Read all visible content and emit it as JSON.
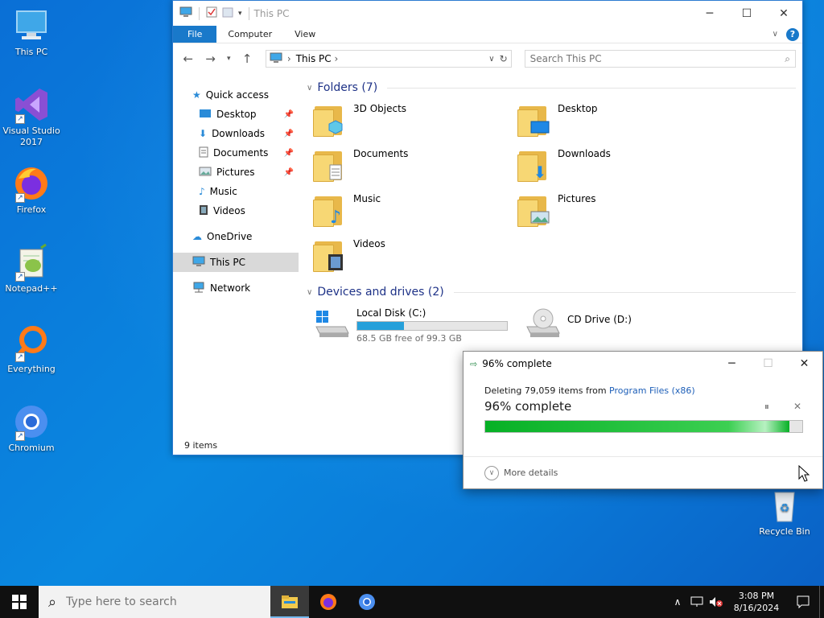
{
  "desktop": {
    "icons": [
      {
        "label": "This PC"
      },
      {
        "label": "Visual Studio 2017"
      },
      {
        "label": "Firefox"
      },
      {
        "label": "Notepad++"
      },
      {
        "label": "Everything"
      },
      {
        "label": "Chromium"
      },
      {
        "label": "Recycle Bin"
      }
    ]
  },
  "explorer": {
    "title": "This PC",
    "ribbon_tabs": [
      "File",
      "Computer",
      "View"
    ],
    "help_label": "?",
    "address": "This PC",
    "search_placeholder": "Search This PC",
    "nav": {
      "quick_access": "Quick access",
      "items": [
        "Desktop",
        "Downloads",
        "Documents",
        "Pictures",
        "Music",
        "Videos"
      ],
      "onedrive": "OneDrive",
      "this_pc": "This PC",
      "network": "Network"
    },
    "folders_header": "Folders (7)",
    "folders": [
      "3D Objects",
      "Desktop",
      "Documents",
      "Downloads",
      "Music",
      "Pictures",
      "Videos"
    ],
    "drives_header": "Devices and drives (2)",
    "drives": [
      {
        "name": "Local Disk (C:)",
        "free": "68.5 GB free of 99.3 GB",
        "used_fraction": 0.31
      },
      {
        "name": "CD Drive (D:)"
      }
    ],
    "status": "9 items"
  },
  "progress_dialog": {
    "title": "96% complete",
    "line_prefix": "Deleting 79,059 items from ",
    "line_link": "Program Files (x86)",
    "main": "96% complete",
    "percent": 96,
    "more_details": "More details"
  },
  "taskbar": {
    "search_placeholder": "Type here to search",
    "time": "3:08 PM",
    "date": "8/16/2024"
  },
  "colors": {
    "accent": "#1979ca",
    "progress_green": "#06b025",
    "drive_bar": "#26a0da"
  }
}
